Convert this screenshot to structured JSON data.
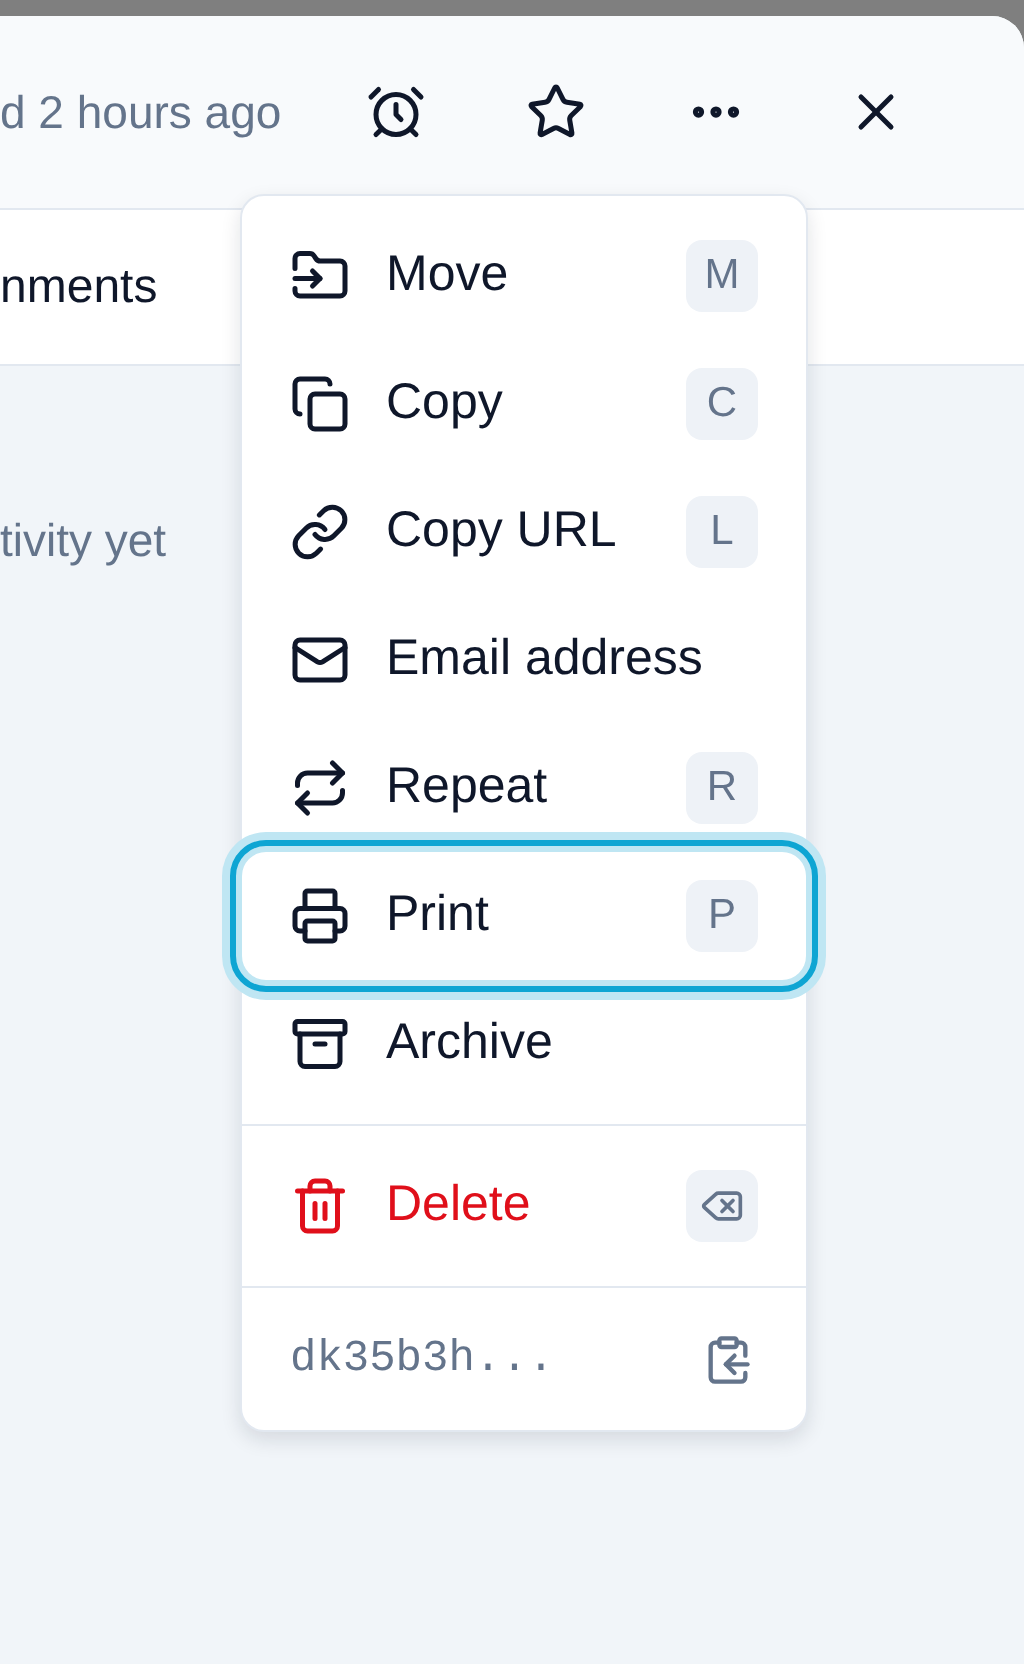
{
  "header": {
    "timestamp": "d 2 hours ago"
  },
  "tab": {
    "label": "nments"
  },
  "body": {
    "empty_text": "tivity yet"
  },
  "menu": {
    "items": [
      {
        "kind": "item",
        "label": "Move",
        "shortcut": "M",
        "selected": false
      },
      {
        "kind": "item",
        "label": "Copy",
        "shortcut": "C",
        "selected": false
      },
      {
        "kind": "item",
        "label": "Copy URL",
        "shortcut": "L",
        "selected": false
      },
      {
        "kind": "item",
        "label": "Email address",
        "selected": false
      },
      {
        "kind": "item",
        "label": "Repeat",
        "shortcut": "R",
        "selected": false
      },
      {
        "kind": "item",
        "label": "Print",
        "shortcut": "P",
        "selected": true
      },
      {
        "kind": "item",
        "label": "Archive",
        "selected": false
      },
      {
        "kind": "danger",
        "label": "Delete",
        "selected": false
      }
    ],
    "id": {
      "text": "dk35b3h..."
    }
  }
}
